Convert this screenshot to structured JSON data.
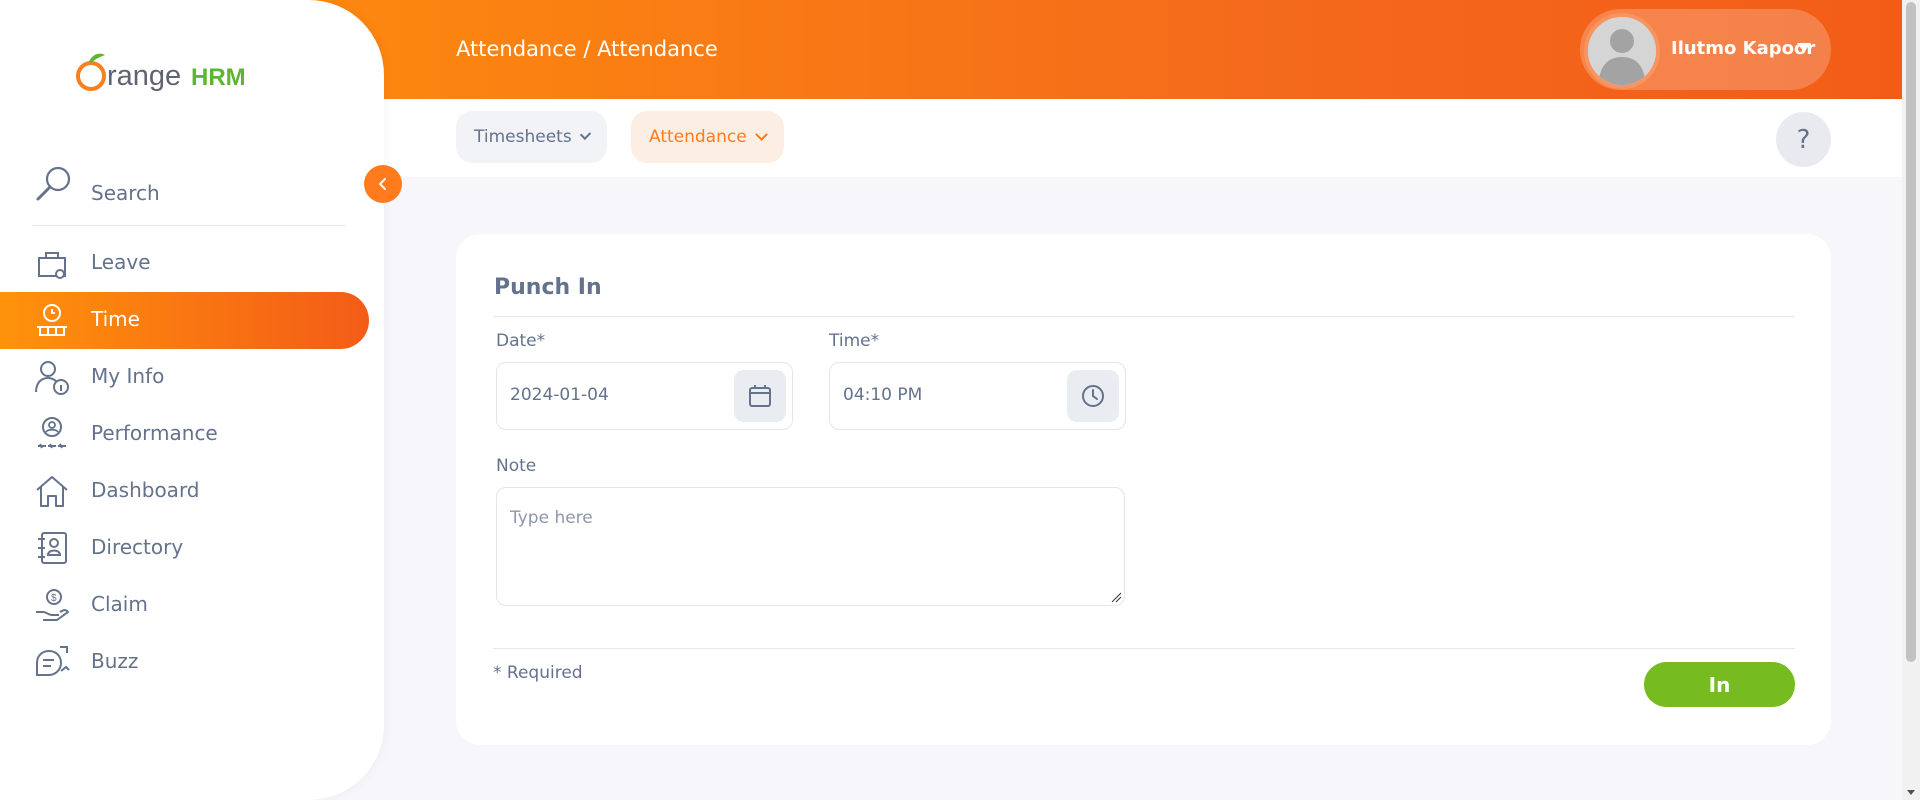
{
  "brand": {
    "logo_part1": "range",
    "logo_part2": "HRM",
    "primary_color": "#ff7b1d",
    "success_color": "#76bc21"
  },
  "header": {
    "breadcrumb": "Attendance / Attendance",
    "user_name": "Ilutmo Kapoor"
  },
  "subnav": {
    "tabs": [
      {
        "label": "Timesheets"
      },
      {
        "label": "Attendance"
      }
    ],
    "help_label": "?"
  },
  "sidebar": {
    "search_label": "Search",
    "items": [
      {
        "label": "Leave",
        "icon": "leave-icon"
      },
      {
        "label": "Time",
        "icon": "time-icon",
        "active": true
      },
      {
        "label": "My Info",
        "icon": "my-info-icon"
      },
      {
        "label": "Performance",
        "icon": "performance-icon"
      },
      {
        "label": "Dashboard",
        "icon": "dashboard-icon"
      },
      {
        "label": "Directory",
        "icon": "directory-icon"
      },
      {
        "label": "Claim",
        "icon": "claim-icon"
      },
      {
        "label": "Buzz",
        "icon": "buzz-icon"
      }
    ]
  },
  "form": {
    "title": "Punch In",
    "date_label": "Date*",
    "date_value": "2024-01-04",
    "time_label": "Time*",
    "time_value": "04:10 PM",
    "note_label": "Note",
    "note_placeholder": "Type here",
    "required_text": "* Required",
    "submit_label": "In"
  }
}
